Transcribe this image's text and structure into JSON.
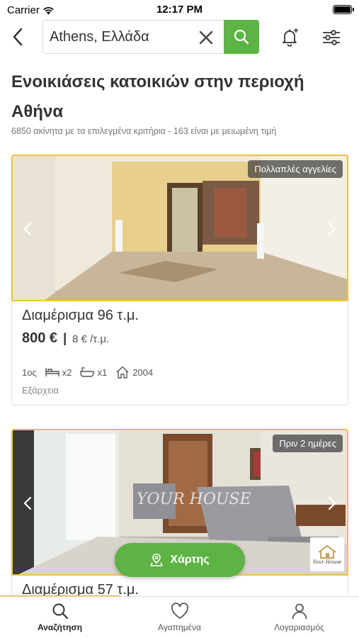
{
  "status_bar": {
    "carrier": "Carrier",
    "time": "12:17 PM"
  },
  "search": {
    "value": "Athens, Ελλάδα",
    "placeholder": ""
  },
  "page": {
    "title": "Ενοικιάσεις κατοικιών στην περιοχή Αθήνα",
    "result_count": "6850 ακίνητα με τα επιλεγμένα κριτήρια - 163 είναι με μειωμένη τιμή"
  },
  "listings": [
    {
      "badge": "Πολλαπλές αγγελίες",
      "title": "Διαμέρισμα 96 τ.μ.",
      "price": "800 €",
      "price_sep": "|",
      "price_per_sqm": "8 € /τ.μ.",
      "floor": "1ος",
      "bedrooms": "x2",
      "bathrooms": "x1",
      "year": "2004",
      "area": "Εξάρχεια"
    },
    {
      "badge": "Πριν 2 ημέρες",
      "title": "Διαμέρισμα 57 τ.μ.",
      "watermark": "YOUR HOUSE",
      "logo_text": "Your House"
    }
  ],
  "map_button": {
    "label": "Χάρτης"
  },
  "tabs": [
    {
      "label": "Αναζήτηση",
      "icon": "search-icon",
      "active": true
    },
    {
      "label": "Αγαπημένα",
      "icon": "heart-icon",
      "active": false
    },
    {
      "label": "Λογαριασμός",
      "icon": "user-icon",
      "active": false
    }
  ],
  "colors": {
    "accent_green": "#5db344",
    "highlight_yellow": "#f0c040",
    "progress_orange": "#f0a820"
  }
}
